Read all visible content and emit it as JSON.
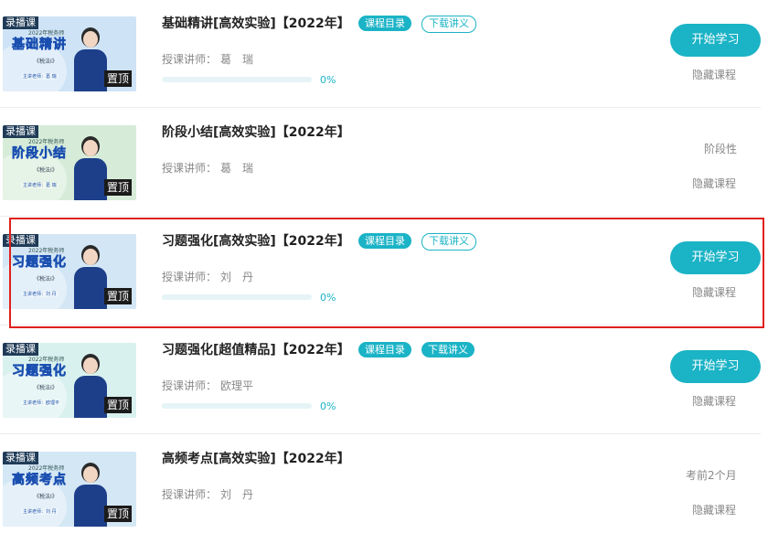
{
  "courses": [
    {
      "thumb": {
        "live_tag": "录播课",
        "year": "2022年税务师",
        "big": "基础精讲",
        "sub": "《税法Ⅰ》",
        "teacher": "主讲老师：葛 瑞",
        "pin": "置顶",
        "bg": "#cfe3f6"
      },
      "title": "基础精讲[高效实验]【2022年】",
      "badges": [
        {
          "label": "课程目录",
          "style": "solid"
        },
        {
          "label": "下载讲义",
          "style": "outline"
        }
      ],
      "teacher_label": "授课讲师：",
      "teacher": "葛　瑞",
      "progress": "0%",
      "progress_value": 0,
      "button": "开始学习",
      "hide": "隐藏课程",
      "status": ""
    },
    {
      "thumb": {
        "live_tag": "录播课",
        "year": "2022年税务师",
        "big": "阶段小结",
        "sub": "《税法Ⅰ》",
        "teacher": "主讲老师：葛 瑞",
        "pin": "置顶",
        "bg": "#d6ecd8"
      },
      "title": "阶段小结[高效实验]【2022年】",
      "badges": [],
      "teacher_label": "授课讲师：",
      "teacher": "葛　瑞",
      "progress": "",
      "progress_value": null,
      "button": "",
      "hide": "隐藏课程",
      "status": "阶段性"
    },
    {
      "thumb": {
        "live_tag": "录播课",
        "year": "2022年税务师",
        "big": "习题强化",
        "sub": "《税法Ⅰ》",
        "teacher": "主讲老师：刘 丹",
        "pin": "置顶",
        "bg": "#d3e6f5"
      },
      "title": "习题强化[高效实验]【2022年】",
      "badges": [
        {
          "label": "课程目录",
          "style": "solid"
        },
        {
          "label": "下载讲义",
          "style": "outline"
        }
      ],
      "teacher_label": "授课讲师：",
      "teacher": "刘　丹",
      "progress": "0%",
      "progress_value": 0,
      "button": "开始学习",
      "hide": "隐藏课程",
      "status": ""
    },
    {
      "thumb": {
        "live_tag": "录播课",
        "year": "2022年税务师",
        "big": "习题强化",
        "sub": "《税法Ⅰ》",
        "teacher": "主讲老师：欧理平",
        "pin": "置顶",
        "bg": "#d9f1ee"
      },
      "title": "习题强化[超值精品]【2022年】",
      "badges": [
        {
          "label": "课程目录",
          "style": "solid"
        },
        {
          "label": "下载讲义",
          "style": "solid"
        }
      ],
      "teacher_label": "授课讲师：",
      "teacher": "欧理平",
      "progress": "0%",
      "progress_value": 0,
      "button": "开始学习",
      "hide": "隐藏课程",
      "status": ""
    },
    {
      "thumb": {
        "live_tag": "录播课",
        "year": "2022年税务师",
        "big": "高频考点",
        "sub": "《税法Ⅰ》",
        "teacher": "主讲老师：刘 丹",
        "pin": "置顶",
        "bg": "#d4e7f5"
      },
      "title": "高频考点[高效实验]【2022年】",
      "badges": [],
      "teacher_label": "授课讲师：",
      "teacher": "刘　丹",
      "progress": "",
      "progress_value": null,
      "button": "",
      "hide": "隐藏课程",
      "status": "考前2个月"
    }
  ],
  "colors": {
    "accent": "#1bb3c6",
    "highlight": "#e0201c"
  }
}
